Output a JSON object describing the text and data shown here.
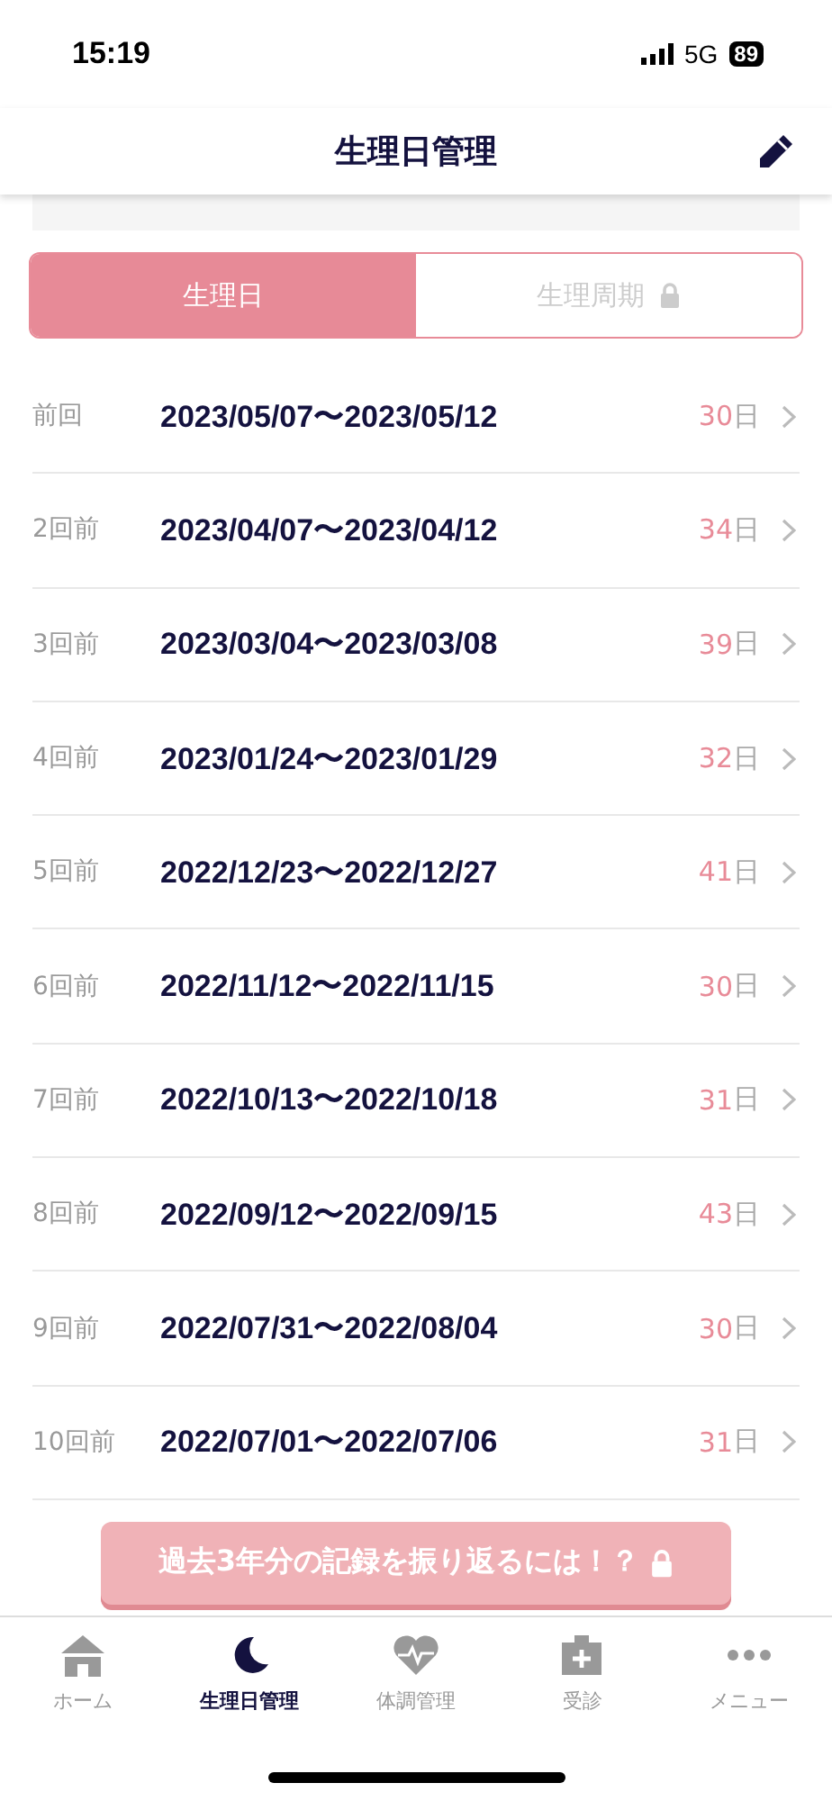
{
  "status_bar": {
    "time": "15:19",
    "network": "5G",
    "battery": "89"
  },
  "header": {
    "title": "生理日管理"
  },
  "segments": [
    {
      "label": "生理日",
      "selected": true,
      "locked": false
    },
    {
      "label": "生理周期",
      "selected": false,
      "locked": true
    }
  ],
  "records": [
    {
      "label": "前回",
      "range": "2023/05/07〜2023/05/12",
      "days": "30",
      "unit": "日"
    },
    {
      "label": "2回前",
      "range": "2023/04/07〜2023/04/12",
      "days": "34",
      "unit": "日"
    },
    {
      "label": "3回前",
      "range": "2023/03/04〜2023/03/08",
      "days": "39",
      "unit": "日"
    },
    {
      "label": "4回前",
      "range": "2023/01/24〜2023/01/29",
      "days": "32",
      "unit": "日"
    },
    {
      "label": "5回前",
      "range": "2022/12/23〜2022/12/27",
      "days": "41",
      "unit": "日"
    },
    {
      "label": "6回前",
      "range": "2022/11/12〜2022/11/15",
      "days": "30",
      "unit": "日"
    },
    {
      "label": "7回前",
      "range": "2022/10/13〜2022/10/18",
      "days": "31",
      "unit": "日"
    },
    {
      "label": "8回前",
      "range": "2022/09/12〜2022/09/15",
      "days": "43",
      "unit": "日"
    },
    {
      "label": "9回前",
      "range": "2022/07/31〜2022/08/04",
      "days": "30",
      "unit": "日"
    },
    {
      "label": "10回前",
      "range": "2022/07/01〜2022/07/06",
      "days": "31",
      "unit": "日"
    }
  ],
  "promo_button": {
    "label": "過去3年分の記録を振り返るには！？",
    "locked": true
  },
  "tab_bar": [
    {
      "label": "ホーム",
      "kind": "home",
      "selected": false
    },
    {
      "label": "生理日管理",
      "kind": "moon",
      "selected": true
    },
    {
      "label": "体調管理",
      "kind": "heart",
      "selected": false
    },
    {
      "label": "受診",
      "kind": "clinic",
      "selected": false
    },
    {
      "label": "メニュー",
      "kind": "more",
      "selected": false
    }
  ]
}
